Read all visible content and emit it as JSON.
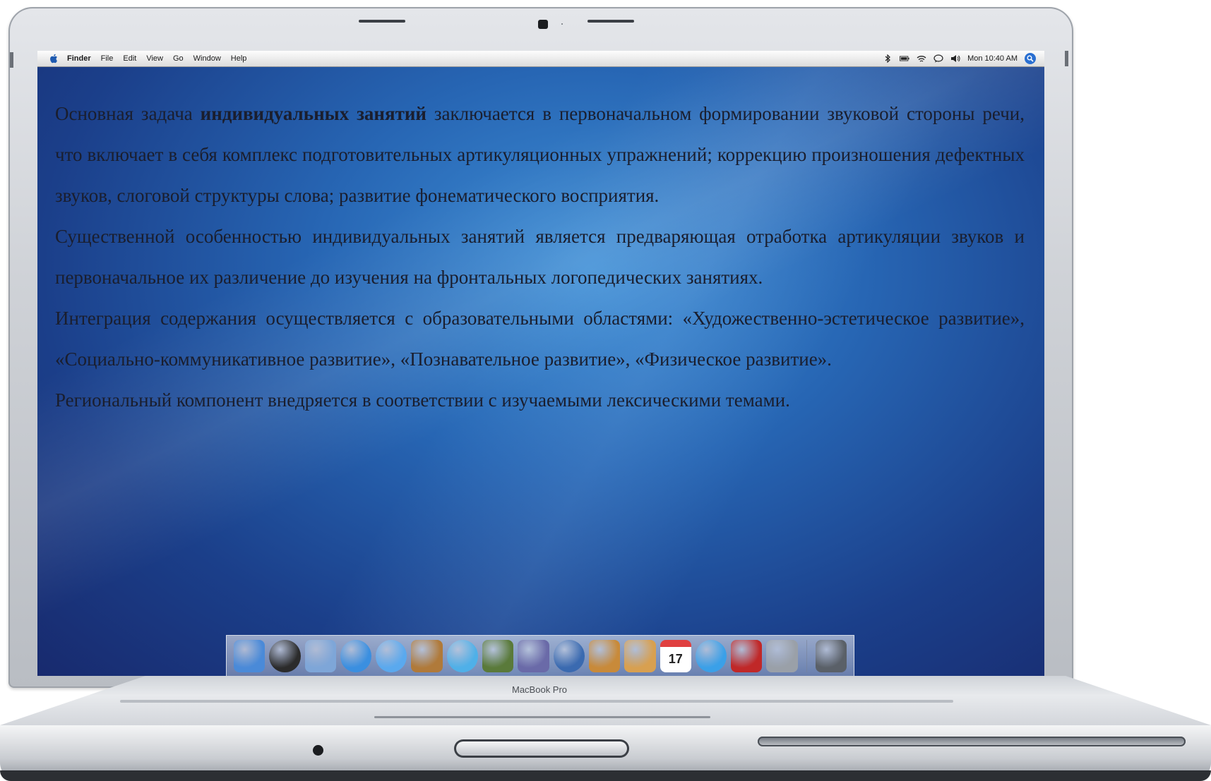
{
  "device": {
    "brand_label": "MacBook Pro"
  },
  "menubar": {
    "app_name": "Finder",
    "items": [
      "File",
      "Edit",
      "View",
      "Go",
      "Window",
      "Help"
    ],
    "status": {
      "icons": [
        "bluetooth-icon",
        "battery-icon",
        "wifi-icon",
        "ichat-icon",
        "volume-icon"
      ],
      "clock": "Mon 10:40 AM",
      "spotlight_icon": "spotlight-icon"
    }
  },
  "content": {
    "p1_pre": "Основная задача ",
    "p1_bold": "индивидуальных занятий",
    "p1_post": " заключается в первоначальном формировании звуковой стороны речи, что включает в себя комплекс подготовительных артикуляционных упражнений; коррекцию произношения дефектных звуков, слоговой структуры слова; развитие фонематического восприятия.",
    "p2": "Существенной особенностью индивидуальных занятий является предваряющая отработка артикуляции звуков и первоначальное их различение до изучения на фронтальных логопедических занятиях.",
    "p3": "Интеграция содержания осуществляется с образовательными областями: «Художественно-эстетическое развитие», «Социально-коммуникативное развитие», «Познавательное развитие», «Физическое развитие».",
    "p4": "Региональный компонент внедряется в соответствии с изучаемыми лексическими темами."
  },
  "dock": {
    "items": [
      {
        "name": "finder-icon",
        "color": "#4a8ad8"
      },
      {
        "name": "dashboard-icon",
        "color": "#2b2b2b"
      },
      {
        "name": "mail-icon",
        "color": "#7ea6d8"
      },
      {
        "name": "safari-icon",
        "color": "#3a8fe0"
      },
      {
        "name": "ichat-icon",
        "color": "#5aa9ee"
      },
      {
        "name": "address-book-icon",
        "color": "#b07a3a"
      },
      {
        "name": "itunes-icon",
        "color": "#4fb0e8"
      },
      {
        "name": "iphoto-icon",
        "color": "#5a7a3a"
      },
      {
        "name": "imovie-icon",
        "color": "#6a6aa8"
      },
      {
        "name": "idvd-icon",
        "color": "#3a6ab0"
      },
      {
        "name": "garageband-icon",
        "color": "#c88a3a"
      },
      {
        "name": "iweb-icon",
        "color": "#d8a050"
      },
      {
        "name": "ical-icon",
        "color": "#e04040"
      },
      {
        "name": "quicktime-icon",
        "color": "#3aa0e8"
      },
      {
        "name": "front-row-icon",
        "color": "#c02828"
      },
      {
        "name": "system-preferences-icon",
        "color": "#9aa0a8"
      },
      {
        "name": "trash-icon",
        "color": "#5a6068"
      }
    ],
    "ical_day": "17"
  }
}
